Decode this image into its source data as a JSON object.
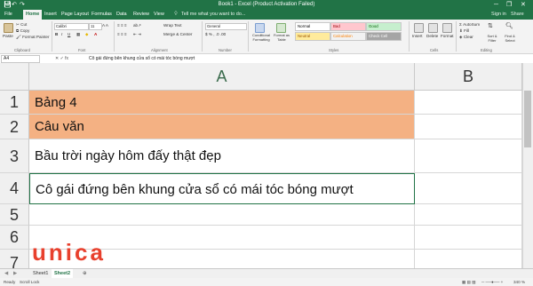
{
  "window": {
    "title": "Book1 - Excel (Product Activation Failed)",
    "quick_access": [
      "save-icon",
      "undo-icon",
      "redo-icon"
    ],
    "controls": [
      "─",
      "❐",
      "✕"
    ]
  },
  "ribbon_tabs": [
    "File",
    "Home",
    "Insert",
    "Page Layout",
    "Formulas",
    "Data",
    "Review",
    "View"
  ],
  "active_tab": "Home",
  "tell_me": "Tell me what you want to do...",
  "account": {
    "sign_in": "Sign in",
    "share": "Share"
  },
  "ribbon": {
    "clipboard": {
      "paste": "Paste",
      "cut": "Cut",
      "copy": "Copy",
      "format_painter": "Format Painter",
      "group": "Clipboard"
    },
    "font": {
      "name": "Calibri",
      "size": "11",
      "group": "Font"
    },
    "alignment": {
      "wrap": "Wrap Text",
      "merge": "Merge & Center",
      "group": "Alignment"
    },
    "number": {
      "format": "General",
      "group": "Number"
    },
    "styles": {
      "conditional": "Conditional Formatting",
      "format_table": "Format as Table",
      "cells": [
        {
          "label": "Normal",
          "bg": "#ffffff",
          "fg": "#000000"
        },
        {
          "label": "Bad",
          "bg": "#ffc7ce",
          "fg": "#9c0006"
        },
        {
          "label": "Good",
          "bg": "#c6efce",
          "fg": "#006100"
        },
        {
          "label": "Neutral",
          "bg": "#ffeb9c",
          "fg": "#9c5700"
        },
        {
          "label": "Calculation",
          "bg": "#f2f2f2",
          "fg": "#fa7d00"
        },
        {
          "label": "Check Cell",
          "bg": "#a5a5a5",
          "fg": "#ffffff"
        }
      ],
      "group": "Styles"
    },
    "cells": {
      "insert": "Insert",
      "delete": "Delete",
      "format": "Format",
      "group": "Cells"
    },
    "editing": {
      "autosum": "AutoSum",
      "fill": "Fill",
      "clear": "Clear",
      "sort": "Sort & Filter",
      "find": "Find & Select",
      "group": "Editing"
    }
  },
  "formula_bar": {
    "name_box": "A4",
    "icons": "✕ ✓ fx",
    "content": "Cô gái đứng bên khung cửa sổ có mái tóc bóng mượt"
  },
  "columns": [
    "A",
    "B"
  ],
  "rows": [
    {
      "num": "1",
      "a": "Bảng 4",
      "fill": "#f4b183"
    },
    {
      "num": "2",
      "a": "Câu văn",
      "fill": "#f4b183"
    },
    {
      "num": "3",
      "a": "Bầu trời ngày hôm đấy thật đẹp",
      "fill": ""
    },
    {
      "num": "4",
      "a": "Cô gái đứng bên khung cửa sổ có mái tóc bóng mượt",
      "fill": ""
    },
    {
      "num": "5",
      "a": "",
      "fill": ""
    },
    {
      "num": "6",
      "a": "",
      "fill": ""
    },
    {
      "num": "7",
      "a": "",
      "fill": ""
    }
  ],
  "sheets": [
    "Sheet1",
    "Sheet2"
  ],
  "active_sheet": "Sheet2",
  "status": {
    "ready": "Ready",
    "scroll_lock": "Scroll Lock",
    "zoom": "340 %"
  },
  "logo": {
    "text": "unica",
    "color": "#e8402d"
  },
  "colors": {
    "accent": "#217346",
    "highlight": "#f4b183"
  }
}
